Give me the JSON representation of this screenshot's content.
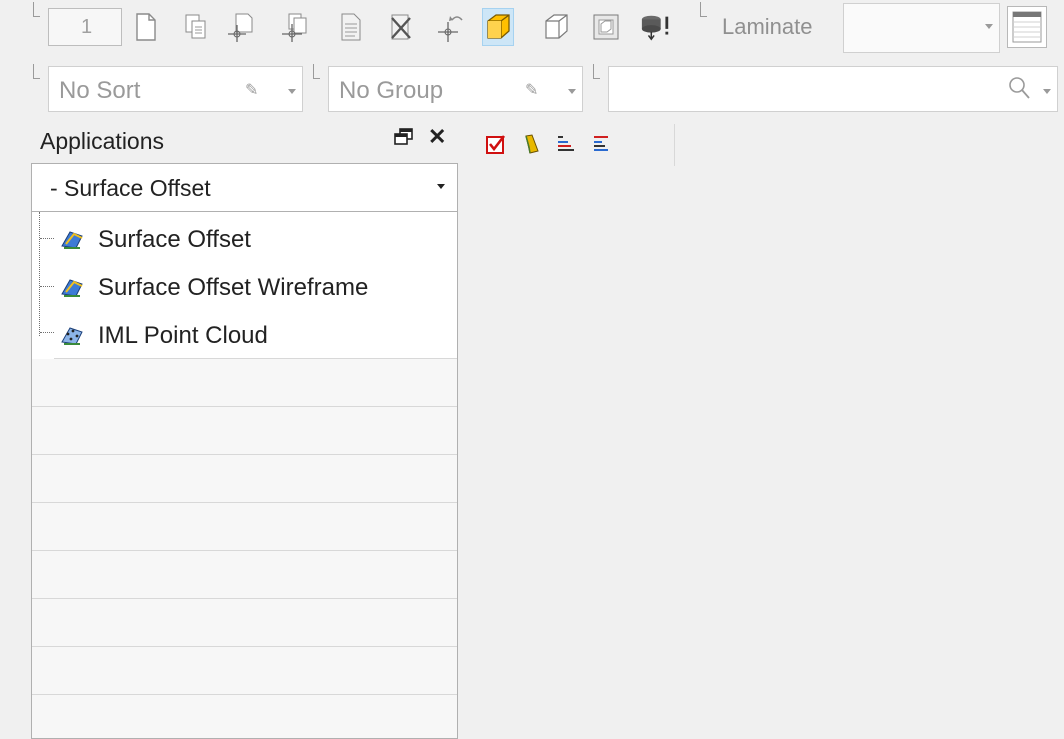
{
  "toolbar": {
    "page_number": "1",
    "laminate_label": "Laminate",
    "laminate_value": "",
    "icons": [
      "new-document-icon",
      "copy-document-icon",
      "add-point-icon",
      "add-point-copy-icon",
      "document-text-icon",
      "delete-document-icon",
      "ply-rotate-icon",
      "solid-cube-icon",
      "wire-cube-icon",
      "inner-cube-icon",
      "database-alert-icon",
      "table-view-icon"
    ]
  },
  "filters": {
    "sort": "No Sort",
    "group": "No Group",
    "search": ""
  },
  "applications": {
    "title": "Applications",
    "selected": "- Surface Offset",
    "items": [
      {
        "label": "Surface Offset",
        "icon": "surface-offset-icon"
      },
      {
        "label": "Surface Offset Wireframe",
        "icon": "surface-offset-wireframe-icon"
      },
      {
        "label": "IML Point Cloud",
        "icon": "point-cloud-icon"
      }
    ]
  },
  "mini_toolbar": [
    "check-icon",
    "brush-icon",
    "align-left-icon",
    "align-center-icon"
  ],
  "colors": {
    "accent": "#ffc000",
    "highlight": "#cde6f7"
  }
}
